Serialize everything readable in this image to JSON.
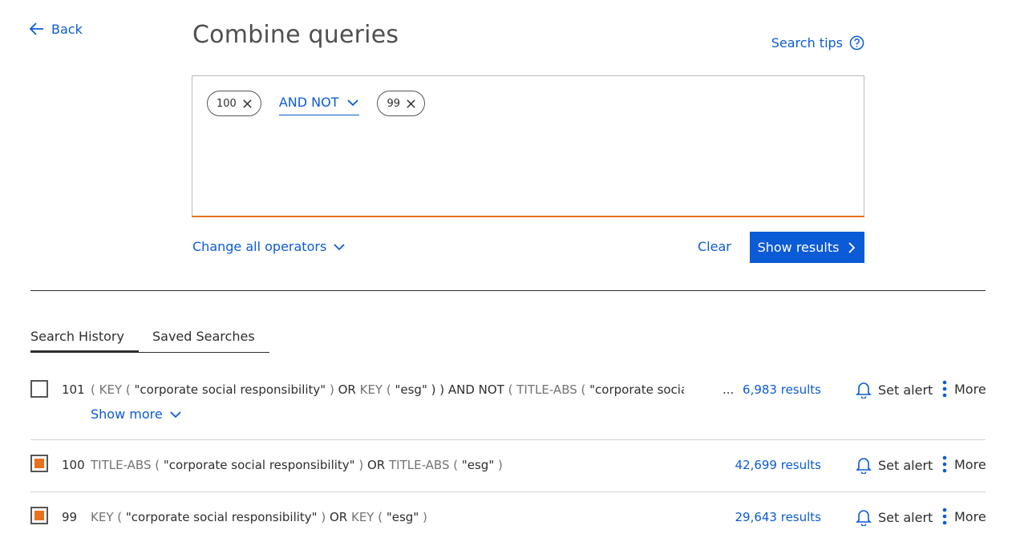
{
  "nav": {
    "back_label": "Back"
  },
  "page": {
    "title": "Combine queries",
    "search_tips": "Search tips"
  },
  "combine": {
    "chip_left": "100",
    "operator": "AND NOT",
    "chip_right": "99",
    "change_all_operators": "Change all operators",
    "clear_label": "Clear",
    "show_results_label": "Show results"
  },
  "tabs": [
    "Search History",
    "Saved Searches"
  ],
  "history": [
    {
      "number": "101",
      "query_parts": [
        {
          "t": "( ",
          "f": true
        },
        {
          "t": "KEY",
          "f": true
        },
        {
          "t": " ( ",
          "f": true
        },
        {
          "t": "\"corporate social responsibility\"",
          "f": false
        },
        {
          "t": " ) ",
          "f": true
        },
        {
          "t": "OR",
          "f": false
        },
        {
          "t": " KEY",
          "f": true
        },
        {
          "t": " ( ",
          "f": true
        },
        {
          "t": "\"esg\"",
          "f": false
        },
        {
          "t": " ) ) ",
          "f": false
        },
        {
          "t": "AND NOT",
          "f": false
        },
        {
          "t": " ( ",
          "f": true
        },
        {
          "t": "TITLE-ABS",
          "f": true
        },
        {
          "t": " ( ",
          "f": true
        },
        {
          "t": "\"corporate social",
          "f": false
        }
      ],
      "ellipsis": "...",
      "results": "6,983 results",
      "checked": false,
      "show_more": "Show more"
    },
    {
      "number": "100",
      "query_parts": [
        {
          "t": "TITLE-ABS",
          "f": true
        },
        {
          "t": " ( ",
          "f": true
        },
        {
          "t": "\"corporate social responsibility\"",
          "f": false
        },
        {
          "t": " ) ",
          "f": true
        },
        {
          "t": "OR",
          "f": false
        },
        {
          "t": " TITLE-ABS",
          "f": true
        },
        {
          "t": " ( ",
          "f": true
        },
        {
          "t": "\"esg\"",
          "f": false
        },
        {
          "t": " )",
          "f": true
        }
      ],
      "results": "42,699 results",
      "checked": true
    },
    {
      "number": "99",
      "query_parts": [
        {
          "t": "KEY",
          "f": true
        },
        {
          "t": " ( ",
          "f": true
        },
        {
          "t": "\"corporate social responsibility\"",
          "f": false
        },
        {
          "t": " ) ",
          "f": true
        },
        {
          "t": "OR",
          "f": false
        },
        {
          "t": " KEY",
          "f": true
        },
        {
          "t": " ( ",
          "f": true
        },
        {
          "t": "\"esg\"",
          "f": false
        },
        {
          "t": " )",
          "f": true
        }
      ],
      "results": "29,643 results",
      "checked": true
    }
  ],
  "row_actions": {
    "set_alert": "Set alert",
    "more": "More"
  },
  "colors": {
    "accent_blue": "#0c5bd6",
    "accent_orange": "#e9711c",
    "muted_field": "#737373"
  },
  "icons": [
    "arrow-left-icon",
    "question-circle-icon",
    "close-icon",
    "chevron-down-icon",
    "chevron-right-icon",
    "bell-icon",
    "kebab-icon"
  ]
}
